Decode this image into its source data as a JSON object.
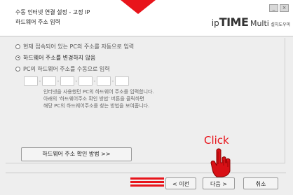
{
  "window": {
    "title": "수동 인터넷 연결 설정 - 고정 IP",
    "subtitle": "하드웨어 주소 입력",
    "brand": {
      "prefix": "ip",
      "name": "TIME",
      "suffix": "Multi",
      "tagline": "설치도우미"
    }
  },
  "options": {
    "items": [
      {
        "label": "현재 접속되어 있는 PC의 주소를 자동으로 입력",
        "checked": false
      },
      {
        "label": "하드웨어 주소를 변경하지 않음",
        "checked": true
      },
      {
        "label": "PC의 하드웨어 주소를 수동으로 입력",
        "checked": false
      }
    ]
  },
  "help": {
    "line1": "인터넷을 사용했던 PC의 하드웨어 주소를 입력합니다.",
    "line2": "아래의 '하드웨어주소 확인 방법' 버튼을 클릭하면",
    "line3": "해당 PC의 하드웨어주소를 찾는 방법을 보여줍니다."
  },
  "buttons": {
    "find_mac": "하드웨어 주소 확인 방법 >>",
    "prev": "< 이전",
    "next": "다음 >",
    "cancel": "취소"
  },
  "overlay": {
    "click_label": "Click"
  },
  "colors": {
    "accent_red": "#e8141b"
  }
}
